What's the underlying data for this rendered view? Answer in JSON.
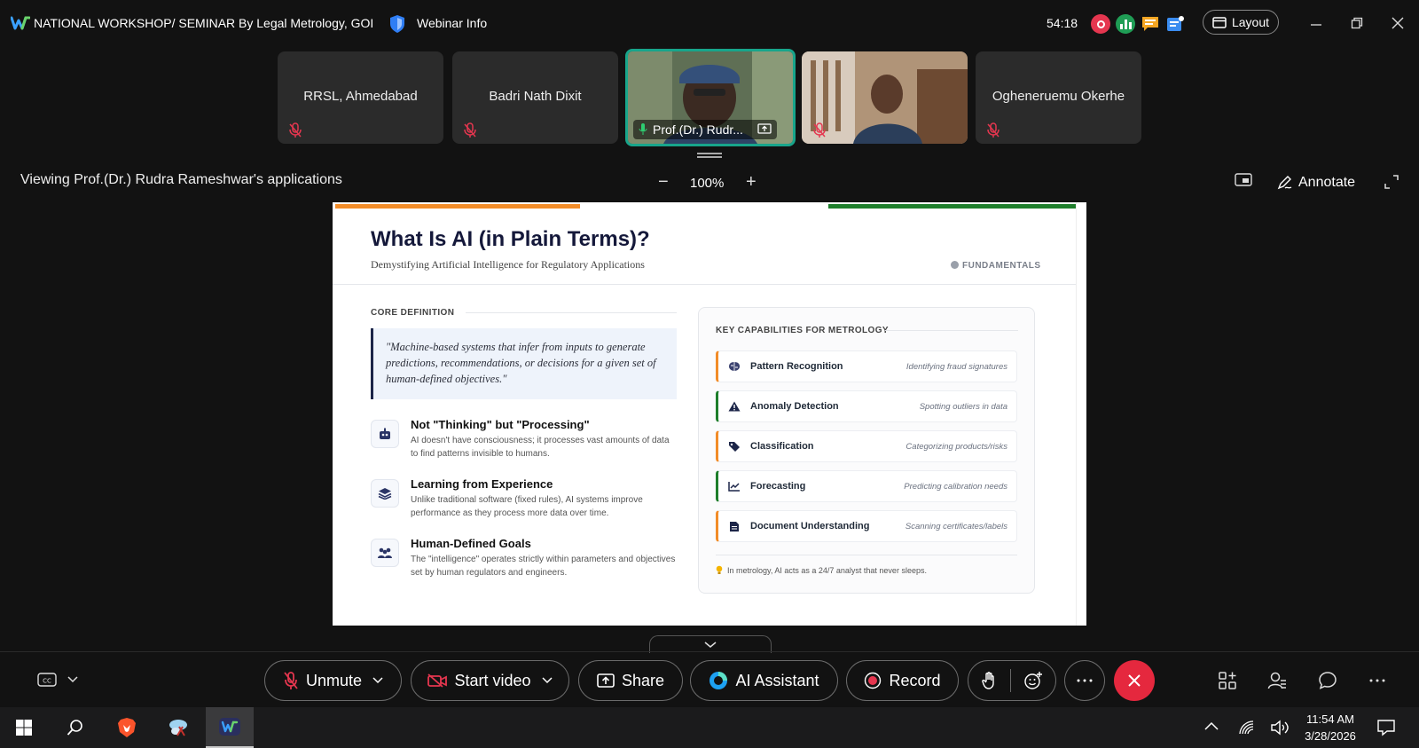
{
  "window": {
    "title": "NATIONAL WORKSHOP/ SEMINAR By Legal Metrology, GOI",
    "webinar_info": "Webinar Info",
    "timer": "54:18",
    "layout_label": "Layout"
  },
  "participants": [
    {
      "name": "RRSL, Ahmedabad",
      "muted": true,
      "video": false
    },
    {
      "name": "Badri Nath  Dixit",
      "muted": true,
      "video": false
    },
    {
      "name": "Prof.(Dr.) Rudr...",
      "muted": false,
      "video": true,
      "active_speaker": true,
      "sharing": true
    },
    {
      "name": "",
      "muted": true,
      "video": true
    },
    {
      "name": "Ogheneruemu Okerhe",
      "muted": true,
      "video": false
    }
  ],
  "share_bar": {
    "viewing_text": "Viewing Prof.(Dr.) Rudra Rameshwar's applications",
    "zoom": "100%",
    "zoom_out": "−",
    "zoom_in": "+",
    "annotate_label": "Annotate"
  },
  "slide": {
    "title": "What Is AI (in Plain Terms)?",
    "subtitle": "Demystifying Artificial Intelligence for Regulatory Applications",
    "tag": "FUNDAMENTALS",
    "core_label": "CORE DEFINITION",
    "quote": "\"Machine-based systems that infer from inputs to generate predictions, recommendations, or decisions for a given set of human-defined objectives.\"",
    "features": [
      {
        "title": "Not \"Thinking\" but \"Processing\"",
        "desc": "AI doesn't have consciousness; it processes vast amounts of data to find patterns invisible to humans.",
        "icon": "robot-icon"
      },
      {
        "title": "Learning from Experience",
        "desc": "Unlike traditional software (fixed rules), AI systems improve performance as they process more data over time.",
        "icon": "layers-icon"
      },
      {
        "title": "Human-Defined Goals",
        "desc": "The \"intelligence\" operates strictly within parameters and objectives set by human regulators and engineers.",
        "icon": "people-icon"
      }
    ],
    "cap_label": "KEY CAPABILITIES FOR METROLOGY",
    "capabilities": [
      {
        "name": "Pattern Recognition",
        "desc": "Identifying fraud signatures",
        "color": "#f28c28",
        "icon": "brain-icon"
      },
      {
        "name": "Anomaly Detection",
        "desc": "Spotting outliers in data",
        "color": "#1e7e2b",
        "icon": "warning-icon"
      },
      {
        "name": "Classification",
        "desc": "Categorizing products/risks",
        "color": "#f28c28",
        "icon": "tag-icon"
      },
      {
        "name": "Forecasting",
        "desc": "Predicting calibration needs",
        "color": "#1e7e2b",
        "icon": "chart-line-icon"
      },
      {
        "name": "Document Understanding",
        "desc": "Scanning certificates/labels",
        "color": "#f28c28",
        "icon": "document-icon"
      }
    ],
    "note": "In metrology, AI acts as a 24/7 analyst that never sleeps."
  },
  "controls": {
    "unmute": "Unmute",
    "start_video": "Start video",
    "share": "Share",
    "ai_assistant": "AI Assistant",
    "record": "Record"
  },
  "taskbar": {
    "time": "11:54 AM",
    "date": "3/28/2026"
  },
  "colors": {
    "accent_green": "#18a58b",
    "end_red": "#e5283e",
    "slide_orange": "#f28c28",
    "slide_green": "#1e7e2b",
    "slide_navy": "#14183a"
  }
}
